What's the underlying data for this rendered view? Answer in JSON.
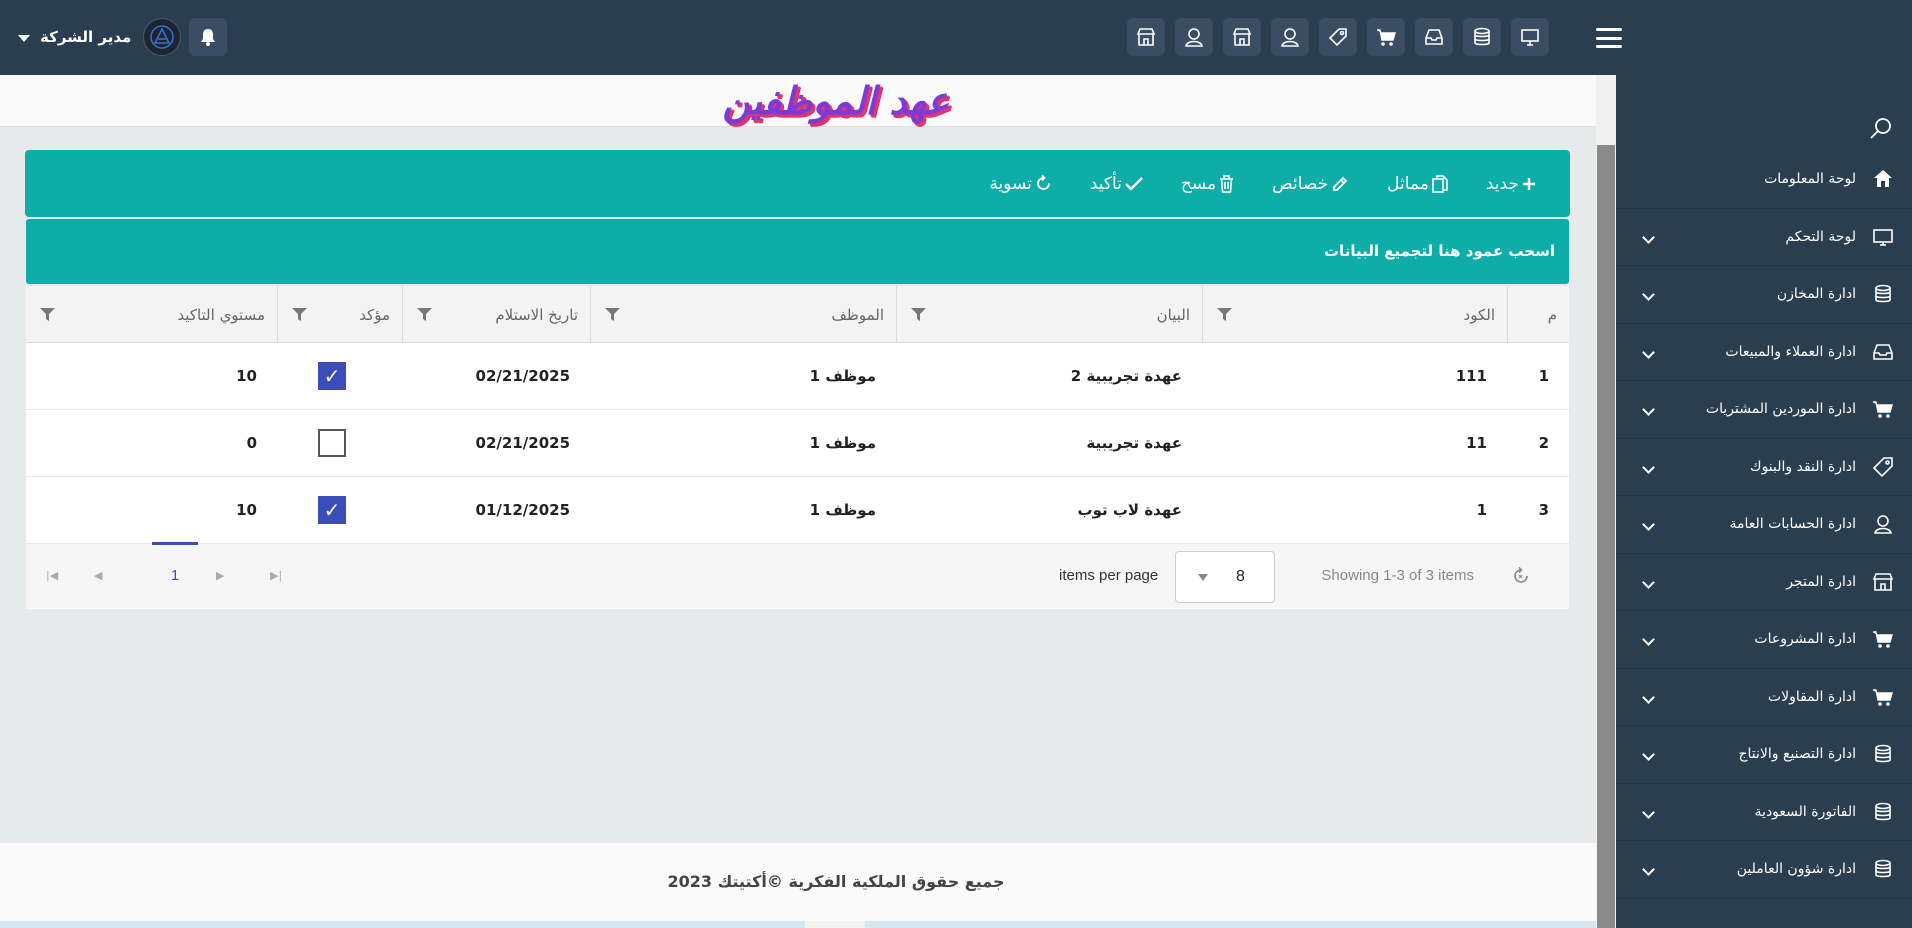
{
  "header": {
    "user_name": "مدير الشركة",
    "top_icons": [
      "store-icon",
      "user-icon",
      "store-icon",
      "user-icon",
      "tag-icon",
      "cart-icon",
      "inbox-icon",
      "database-icon",
      "monitor-icon"
    ]
  },
  "sidebar": {
    "items": [
      {
        "label": "لوحة المعلومات",
        "icon": "home-icon"
      },
      {
        "label": "لوحة التحكم",
        "icon": "monitor-icon"
      },
      {
        "label": "ادارة المخازن",
        "icon": "database-icon"
      },
      {
        "label": "ادارة العملاء والمبيعات",
        "icon": "inbox-icon"
      },
      {
        "label": "ادارة الموردين المشتريات",
        "icon": "cart-icon"
      },
      {
        "label": "ادارة النقد والبنوك",
        "icon": "tag-icon"
      },
      {
        "label": "ادارة الحسابات العامة",
        "icon": "user-icon"
      },
      {
        "label": "ادارة المتجر",
        "icon": "store-icon"
      },
      {
        "label": "ادارة المشروعات",
        "icon": "cart-icon"
      },
      {
        "label": "ادارة المقاولات",
        "icon": "cart-icon"
      },
      {
        "label": "ادارة التصنيع والانتاج",
        "icon": "database-icon"
      },
      {
        "label": "الفاتورة السعودية",
        "icon": "database-icon"
      },
      {
        "label": "ادارة شؤون العاملين",
        "icon": "database-icon"
      }
    ]
  },
  "page": {
    "title": "عهد الموظفين"
  },
  "toolbar": {
    "new": "جديد",
    "similar": "مماثل",
    "properties": "خصائص",
    "delete": "مسح",
    "confirm": "تأكيد",
    "settle": "تسوية"
  },
  "grid": {
    "group_hint": "اسحب عمود هنا لتجميع البيانات",
    "columns": {
      "no": "م",
      "code": "الكود",
      "statement": "البيان",
      "employee": "الموظف",
      "receive_date": "تاريخ الاستلام",
      "confirmed": "مؤكد",
      "confirm_level": "مستوي التاكيد"
    },
    "rows": [
      {
        "no": "1",
        "code": "111",
        "statement": "عهدة تجريبية 2",
        "employee": "موظف 1",
        "receive_date": "02/21/2025",
        "confirmed": true,
        "confirm_level": "10"
      },
      {
        "no": "2",
        "code": "11",
        "statement": "عهدة تجريبية",
        "employee": "موظف 1",
        "receive_date": "02/21/2025",
        "confirmed": false,
        "confirm_level": "0"
      },
      {
        "no": "3",
        "code": "1",
        "statement": "عهدة لاب توب",
        "employee": "موظف 1",
        "receive_date": "01/12/2025",
        "confirmed": true,
        "confirm_level": "10"
      }
    ]
  },
  "pager": {
    "info": "Showing 1-3 of 3 items",
    "page_size": "8",
    "per_page_label": "items per page",
    "current_page": "1"
  },
  "footer": {
    "text": "جميع حقوق الملكية الفكرية ©أكتيتك 2023"
  },
  "colors": {
    "navy": "#2b3e50",
    "teal": "#0eada8",
    "check_blue": "#3b4db8"
  }
}
